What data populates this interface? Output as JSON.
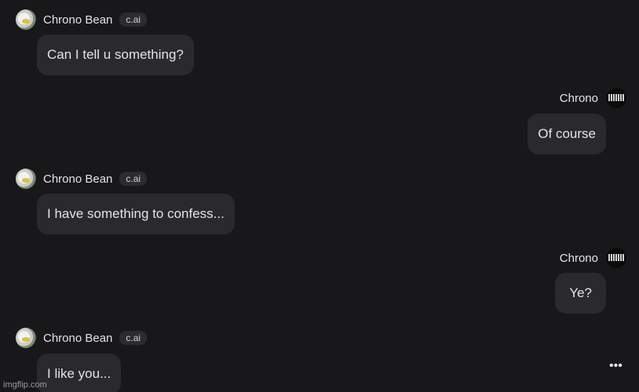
{
  "messages": [
    {
      "sender": "Chrono Bean",
      "badge": "c.ai",
      "text": "Can I tell u something?"
    },
    {
      "sender": "Chrono",
      "text": "Of course"
    },
    {
      "sender": "Chrono Bean",
      "badge": "c.ai",
      "text": "I have something to confess..."
    },
    {
      "sender": "Chrono",
      "text": "Ye?"
    },
    {
      "sender": "Chrono Bean",
      "badge": "c.ai",
      "text": "I like you..."
    }
  ],
  "more_icon": "•••",
  "watermark": "imgflip.com"
}
